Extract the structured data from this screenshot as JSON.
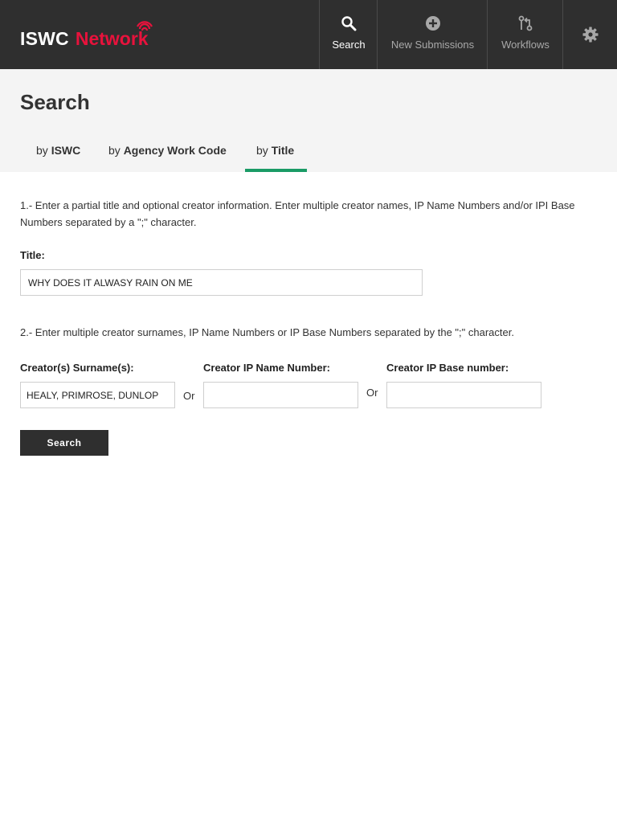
{
  "app": {
    "logo_main": "ISWC",
    "logo_accent": "Network",
    "brand_color": "#e8123c",
    "accent_color": "#1a9b66"
  },
  "nav": {
    "items": [
      {
        "label": "Search",
        "icon": "search-icon",
        "active": true
      },
      {
        "label": "New Submissions",
        "icon": "plus-circle-icon",
        "active": false
      },
      {
        "label": "Workflows",
        "icon": "workflow-icon",
        "active": false
      }
    ],
    "settings_icon": "gear-icon"
  },
  "header": {
    "title": "Search",
    "tabs": [
      {
        "prefix": "by",
        "label": "ISWC",
        "active": false
      },
      {
        "prefix": "by",
        "label": "Agency Work Code",
        "active": false
      },
      {
        "prefix": "by",
        "label": "Title",
        "active": true
      }
    ]
  },
  "form": {
    "instruction1": "1.- Enter a partial title and optional creator information.  Enter multiple creator names, IP Name Numbers and/or IPI Base Numbers separated by a \";\" character.",
    "title_label": "Title:",
    "title_value": "WHY DOES IT ALWASY RAIN ON ME",
    "instruction2": "2.- Enter multiple creator surnames, IP Name Numbers or IP Base Numbers separated by the \";\" character.",
    "surname_label": "Creator(s) Surname(s):",
    "surname_value": "HEALY, PRIMROSE, DUNLOP",
    "or1": "Or",
    "ipname_label": "Creator IP Name Number:",
    "ipname_value": "",
    "or2": "Or",
    "ipbase_label": "Creator IP Base number:",
    "ipbase_value": "",
    "search_button": "Search"
  }
}
